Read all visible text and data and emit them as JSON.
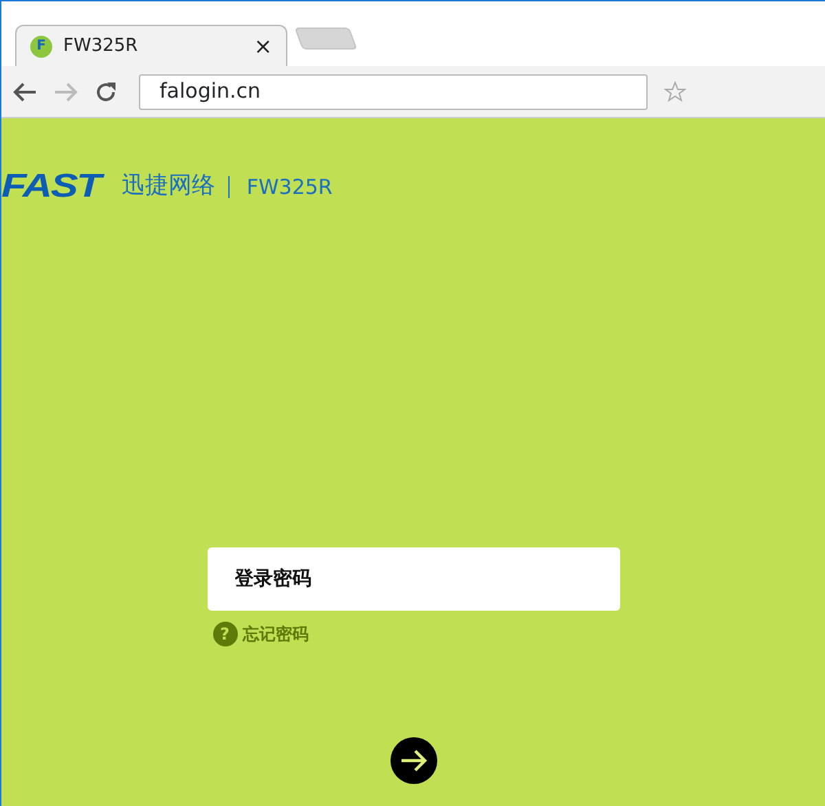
{
  "browser": {
    "tabs": [
      {
        "title": "FW325R",
        "favicon": "F",
        "close": "×",
        "selected": true
      }
    ],
    "url": "falogin.cn"
  },
  "header": {
    "logo": "FAST",
    "brand": "迅捷网络",
    "model": "FW325R"
  },
  "login": {
    "password": {
      "placeholder": "登录密码"
    },
    "forgot_icon": "?",
    "forgot": "忘记密码"
  }
}
